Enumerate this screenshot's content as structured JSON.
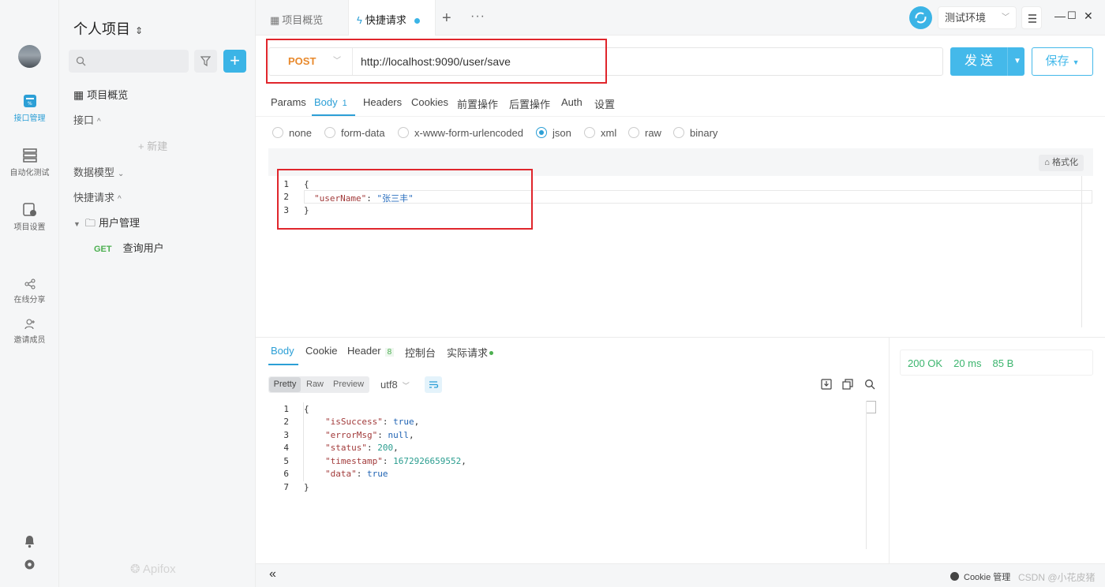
{
  "rail": {
    "items": [
      {
        "label": "接口管理",
        "icon": "api-icon",
        "active": true
      },
      {
        "label": "自动化测试",
        "icon": "test-icon"
      },
      {
        "label": "项目设置",
        "icon": "settings-doc-icon"
      },
      {
        "label": "在线分享",
        "icon": "share-icon"
      },
      {
        "label": "邀请成员",
        "icon": "invite-icon"
      }
    ]
  },
  "sidebar": {
    "project_title": "个人项目",
    "overview": "项目概览",
    "interfaces": "接口",
    "new": "新建",
    "data_models": "数据模型",
    "quick_requests": "快捷请求",
    "folder": "用户管理",
    "request_method": "GET",
    "request_name": "查询用户",
    "logo": "Apifox"
  },
  "tabs": {
    "overview": "项目概览",
    "quick": "快捷请求",
    "add": "+",
    "more": "···"
  },
  "env": {
    "name": "测试环境"
  },
  "request": {
    "method": "POST",
    "url": "http://localhost:9090/user/save",
    "send": "发送",
    "save": "保存",
    "tabs": [
      "Params",
      "Body",
      "Headers",
      "Cookies",
      "前置操作",
      "后置操作",
      "Auth",
      "设置"
    ],
    "body_count": "1",
    "body_types": [
      "none",
      "form-data",
      "x-www-form-urlencoded",
      "json",
      "xml",
      "raw",
      "binary"
    ],
    "selected_body_type": "json",
    "format": "格式化",
    "body_lines": [
      "{",
      "\"userName\": \"张三丰\"",
      "}"
    ]
  },
  "response": {
    "tabs": [
      "Body",
      "Cookie",
      "Header",
      "控制台",
      "实际请求"
    ],
    "header_count": "8",
    "views": [
      "Pretty",
      "Raw",
      "Preview"
    ],
    "encoding": "utf8",
    "status": "200 OK",
    "time": "20 ms",
    "size": "85 B",
    "line_numbers": [
      "1",
      "2",
      "3",
      "4",
      "5",
      "6",
      "7"
    ]
  },
  "footer": {
    "collapse": "«",
    "cookie_manager": "Cookie 管理",
    "watermark": "CSDN @小花皮猪"
  },
  "colors": {
    "accent": "#44b9ea",
    "post": "#e8892c",
    "get": "#4caf50",
    "status_ok": "#3cb56e",
    "highlight": "#e0262c"
  }
}
